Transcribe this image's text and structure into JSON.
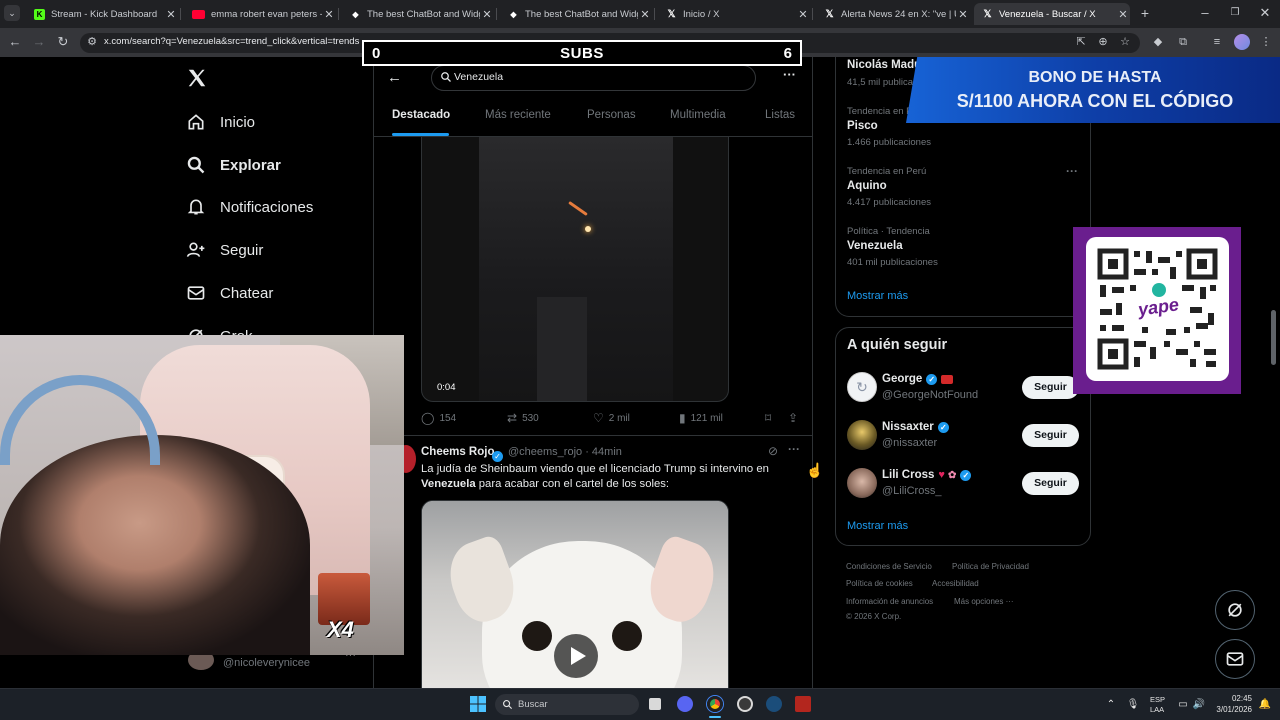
{
  "browser": {
    "tabs": [
      {
        "title": "Stream - Kick Dashboard",
        "favicon": "kick-icon",
        "color": "#53fc18"
      },
      {
        "title": "emma robert evan peters - You",
        "favicon": "youtube-icon",
        "color": "#ff0033"
      },
      {
        "title": "The best ChatBot and Widgets",
        "favicon": "chatbot-icon",
        "color": "#ffffff"
      },
      {
        "title": "The best ChatBot and Widgets",
        "favicon": "chatbot-icon",
        "color": "#ffffff"
      },
      {
        "title": "Inicio / X",
        "favicon": "x-icon",
        "color": "#ffffff"
      },
      {
        "title": "Alerta News 24 en X: \"ve | URGE",
        "favicon": "x-icon",
        "color": "#ffffff"
      },
      {
        "title": "Venezuela - Buscar / X",
        "favicon": "x-icon",
        "color": "#ffffff"
      }
    ],
    "url": "x.com/search?q=Venezuela&src=trend_click&vertical=trends"
  },
  "overlay": {
    "subs_left": "0",
    "subs_label": "SUBS",
    "subs_right": "6",
    "promo_line1": "BONO DE HASTA",
    "promo_line2": "S/1100 AHORA CON EL CÓDIGO",
    "qr_brand": "yape",
    "webcam_badge": "X4"
  },
  "sidebar": {
    "items": [
      {
        "label": "Inicio",
        "icon": "home-icon"
      },
      {
        "label": "Explorar",
        "icon": "search-icon"
      },
      {
        "label": "Notificaciones",
        "icon": "bell-icon"
      },
      {
        "label": "Seguir",
        "icon": "follow-icon"
      },
      {
        "label": "Chatear",
        "icon": "mail-icon"
      },
      {
        "label": "Grok",
        "icon": "grok-icon"
      }
    ],
    "account_handle": "@nicoleverynicee"
  },
  "center": {
    "search_value": "Venezuela",
    "tabs": [
      "Destacado",
      "Más reciente",
      "Personas",
      "Multimedia",
      "Listas"
    ],
    "tweet1": {
      "video_time": "0:04",
      "replies": "154",
      "retweets": "530",
      "likes": "2 mil",
      "views": "121 mil"
    },
    "tweet2": {
      "name": "Cheems Rojo",
      "handle_time": "@cheems_rojo · 44min",
      "text_part1": "La judía de Sheinbaum viendo que el licenciado Trump si intervino en ",
      "text_bold": "Venezuela",
      "text_part2": " para acabar con el cartel de los soles:"
    }
  },
  "right": {
    "trends": [
      {
        "context": "",
        "name": "Nicolás Maduro",
        "count": "41,5 mil publicaciones"
      },
      {
        "context": "Tendencia en Perú",
        "name": "Pisco",
        "count": "1.466 publicaciones"
      },
      {
        "context": "Tendencia en Perú",
        "name": "Aquino",
        "count": "4.417 publicaciones"
      },
      {
        "context": "Política · Tendencia",
        "name": "Venezuela",
        "count": "401 mil publicaciones"
      }
    ],
    "show_more": "Mostrar más",
    "follow_title": "A quién seguir",
    "follow": [
      {
        "name": "George",
        "handle": "@GeorgeNotFound",
        "button": "Seguir"
      },
      {
        "name": "Nissaxter",
        "handle": "@nissaxter",
        "button": "Seguir"
      },
      {
        "name": "Lili Cross",
        "handle": "@LiliCross_",
        "button": "Seguir"
      }
    ],
    "show_more2": "Mostrar más",
    "footer": {
      "l1a": "Condiciones de Servicio",
      "l1b": "Política de Privacidad",
      "l2a": "Política de cookies",
      "l2b": "Accesibilidad",
      "l3a": "Información de anuncios",
      "l3b": "Más opciones ···",
      "copyright": "© 2026 X Corp."
    }
  },
  "taskbar": {
    "search_placeholder": "Buscar",
    "lang1": "ESP",
    "lang2": "LAA",
    "time": "02:45",
    "date": "3/01/2026"
  },
  "colors": {
    "accent": "#1d9bf0",
    "background": "#000000",
    "promo_blue": "#0e3fa8",
    "yape_purple": "#6a1e8e"
  }
}
